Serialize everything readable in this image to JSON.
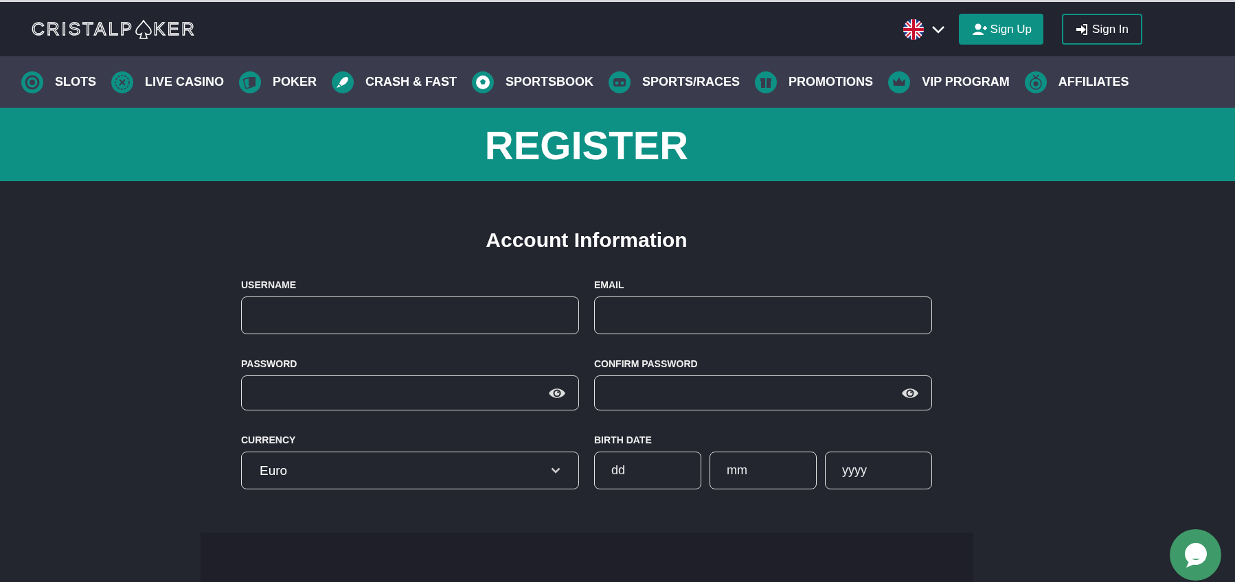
{
  "logo": {
    "before": "CRISTALP",
    "after": "KER"
  },
  "header": {
    "sign_up": "Sign Up",
    "sign_in": "Sign In"
  },
  "nav": [
    {
      "label": "SLOTS"
    },
    {
      "label": "LIVE CASINO"
    },
    {
      "label": "POKER"
    },
    {
      "label": "CRASH & FAST"
    },
    {
      "label": "SPORTSBOOK"
    },
    {
      "label": "SPORTS/RACES"
    },
    {
      "label": "PROMOTIONS"
    },
    {
      "label": "VIP PROGRAM"
    },
    {
      "label": "AFFILIATES"
    }
  ],
  "banner": {
    "title": "REGISTER"
  },
  "form": {
    "title": "Account Information",
    "fields": [
      {
        "kind": "text",
        "label": "USERNAME"
      },
      {
        "kind": "text",
        "label": "EMAIL"
      },
      {
        "kind": "password",
        "label": "PASSWORD"
      },
      {
        "kind": "password",
        "label": "CONFIRM PASSWORD"
      },
      {
        "kind": "select",
        "label": "CURRENCY",
        "value": "Euro"
      },
      {
        "kind": "date",
        "label": "BIRTH DATE",
        "parts": [
          {
            "placeholder": "dd"
          },
          {
            "placeholder": "mm"
          },
          {
            "placeholder": "yyyy"
          }
        ]
      }
    ]
  }
}
